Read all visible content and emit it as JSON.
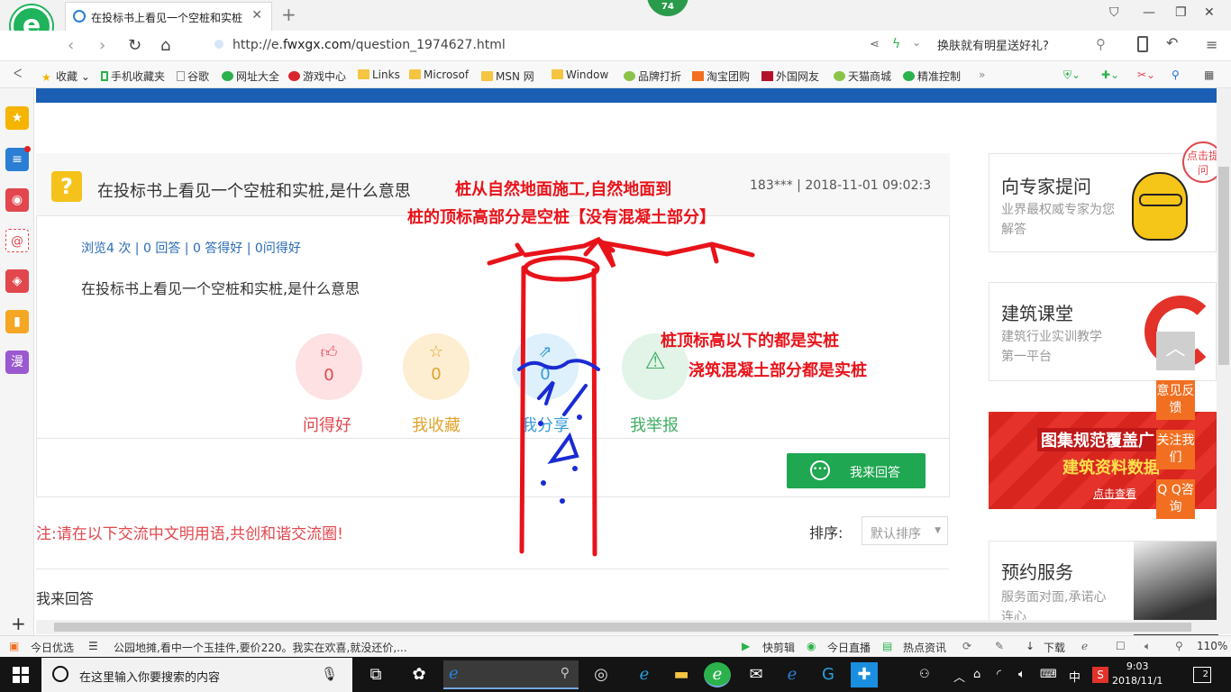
{
  "browser": {
    "tab_title": "在投标书上看见一个空桩和实桩",
    "new_tab": "+",
    "badge": "74",
    "url_prefix": "http://e.",
    "url_domain": "fwxgx.com",
    "url_path": "/question_1974627.html",
    "search_text": "换肤就有明星送好礼?",
    "favorites": [
      {
        "label": "收藏"
      },
      {
        "label": "手机收藏夹"
      },
      {
        "label": "谷歌"
      },
      {
        "label": "网址大全"
      },
      {
        "label": "游戏中心"
      },
      {
        "label": "Links"
      },
      {
        "label": "Microsof"
      },
      {
        "label": "MSN 网"
      },
      {
        "label": "Window"
      },
      {
        "label": "品牌打折"
      },
      {
        "label": "淘宝团购"
      },
      {
        "label": "外国网友"
      },
      {
        "label": "天猫商城"
      },
      {
        "label": "精准控制"
      }
    ]
  },
  "question": {
    "title": "在投标书上看见一个空桩和实桩,是什么意思",
    "meta": "183*** | 2018-11-01 09:02:3",
    "stats": "浏览4 次 | 0 回答 | 0 答得好 | 0问得好",
    "body": "在投标书上看见一个空桩和实桩,是什么意思",
    "actions": [
      {
        "label": "问得好",
        "count": "0",
        "color": "#e2474e",
        "bg": "#fde1e3"
      },
      {
        "label": "我收藏",
        "count": "0",
        "color": "#e0a42c",
        "bg": "#fdeed2"
      },
      {
        "label": "我分享",
        "count": "0",
        "color": "#3a9bd9",
        "bg": "#ddf0fb"
      },
      {
        "label": "我举报",
        "count": "",
        "color": "#3fae62",
        "bg": "#e1f4e7"
      }
    ],
    "answer_button": "我来回答"
  },
  "comments": {
    "notice": "注:请在以下交流中文明用语,共创和谐交流圈!",
    "sort_label": "排序:",
    "sort_value": "默认排序",
    "my_answer": "我来回答"
  },
  "right": {
    "ask_expert_title": "向专家提问",
    "ask_expert_sub": "业界最权威专家为您解答",
    "ask_bubble": "点击提问",
    "class_title": "建筑课堂",
    "class_sub": "建筑行业实训教学第一平台",
    "banner_line1": "图集规范覆盖广",
    "banner_line2": "建筑资料数据",
    "banner_link": "点击查看",
    "appoint_title": "预约服务",
    "appoint_sub": "服务面对面,承诺心连心",
    "float_feedback": "意见反馈",
    "float_follow": "关注我们",
    "float_qq": "Q Q咨询"
  },
  "annotations": {
    "line1": "桩从自然地面施工,自然地面到",
    "line2": "桩的顶标高部分是空桩【没有混凝土部分】",
    "line3": "桩顶标高以下的都是实桩",
    "line4": "浇筑混凝土部分都是实桩"
  },
  "statusbar": {
    "today": "今日优选",
    "news": "公园地摊,看中一个玉挂件,要价220。我实在欢喜,就没还价,...",
    "clip": "快剪辑",
    "live": "今日直播",
    "hot": "热点资讯",
    "download": "下载",
    "zoom": "110%"
  },
  "taskbar": {
    "search_placeholder": "在这里输入你要搜索的内容",
    "ime": "中",
    "time": "9:03",
    "date": "2018/11/1",
    "notifications": "2"
  }
}
